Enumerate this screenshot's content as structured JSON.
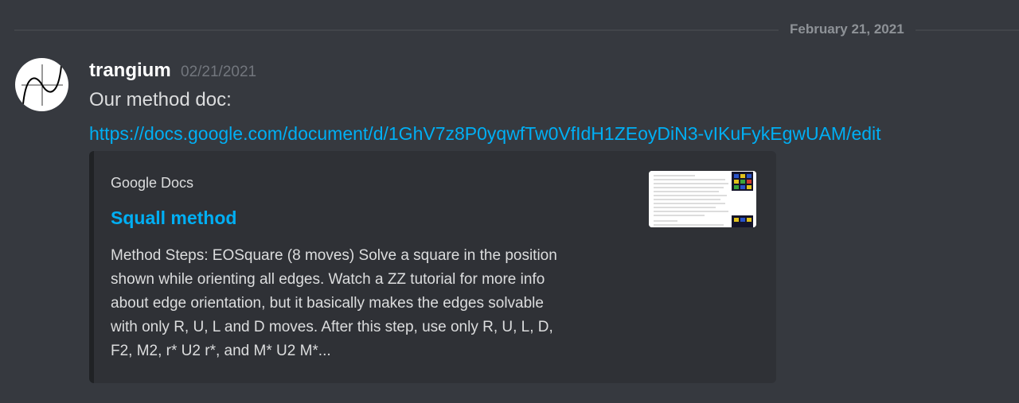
{
  "date_divider": {
    "label": "February 21, 2021"
  },
  "message": {
    "author": "trangium",
    "timestamp": "02/21/2021",
    "text": "Our method doc:",
    "link": "https://docs.google.com/document/d/1GhV7z8P0yqwfTw0VfIdH1ZEoyDiN3-vIKuFykEgwUAM/edit",
    "avatar_icon": "cubic-curve-graph-icon"
  },
  "embed": {
    "provider": "Google Docs",
    "title": "Squall method",
    "description": "Method Steps: EOSquare (8 moves) Solve a square in the position\nshown while orienting all edges. Watch a ZZ tutorial for more info\nabout edge orientation, but it basically makes the edges solvable\nwith only R, U, L and D moves. After this step, use only R, U, L, D,\nF2, M2, r* U2 r*, and M* U2 M*...",
    "thumbnail_icon": "document-preview-thumbnail"
  },
  "colors": {
    "background": "#36393f",
    "embed_background": "#2f3136",
    "link": "#00aff4",
    "username": "#ffffff",
    "muted": "#72767d"
  }
}
